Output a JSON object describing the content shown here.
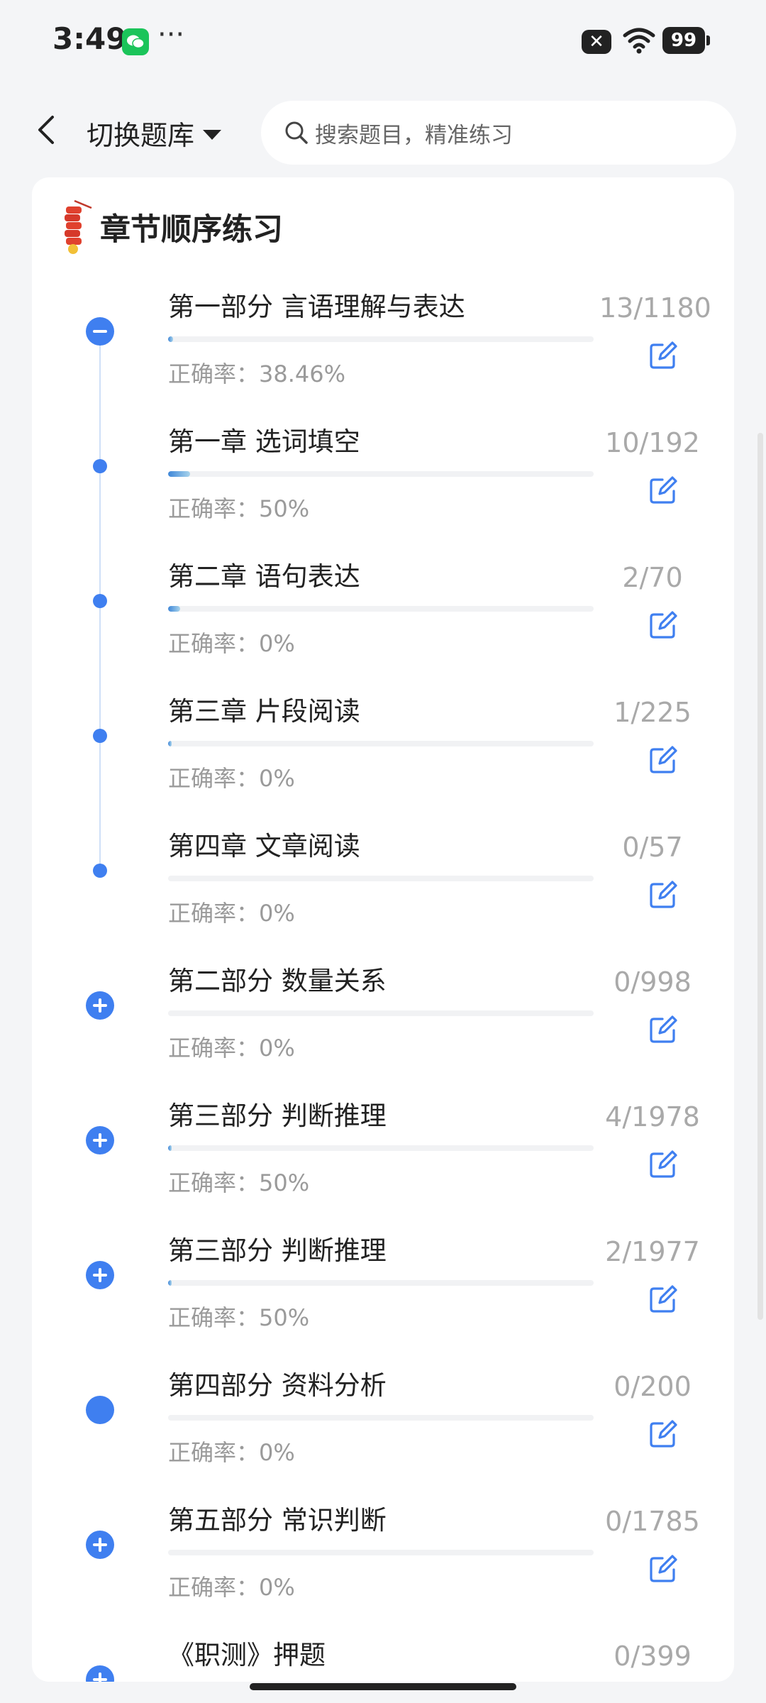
{
  "status": {
    "time": "3:49",
    "dots": "···",
    "battery": "99"
  },
  "header": {
    "switch_label": "切换题库",
    "search_placeholder": "搜索题目，精准练习"
  },
  "card": {
    "title": "章节顺序练习"
  },
  "colors": {
    "accent": "#3f7ff0",
    "count": "#a9a9a9",
    "muted": "#9a9a9a"
  },
  "items": [
    {
      "title": "第一部分 言语理解与表达",
      "count": "13/1180",
      "accuracy": "正确率：38.46%",
      "progress": 0.011,
      "node": "minus"
    },
    {
      "title": "第一章 选词填空",
      "count": "10/192",
      "accuracy": "正确率：50%",
      "progress": 0.052,
      "node": "dot"
    },
    {
      "title": "第二章 语句表达",
      "count": "2/70",
      "accuracy": "正确率：0%",
      "progress": 0.029,
      "node": "dot"
    },
    {
      "title": "第三章 片段阅读",
      "count": "1/225",
      "accuracy": "正确率：0%",
      "progress": 0.004,
      "node": "dot"
    },
    {
      "title": "第四章 文章阅读",
      "count": "0/57",
      "accuracy": "正确率：0%",
      "progress": 0,
      "node": "dot"
    },
    {
      "title": "第二部分 数量关系",
      "count": "0/998",
      "accuracy": "正确率：0%",
      "progress": 0,
      "node": "plus"
    },
    {
      "title": "第三部分 判断推理",
      "count": "4/1978",
      "accuracy": "正确率：50%",
      "progress": 0.002,
      "node": "plus"
    },
    {
      "title": "第三部分 判断推理",
      "count": "2/1977",
      "accuracy": "正确率：50%",
      "progress": 0.001,
      "node": "plus"
    },
    {
      "title": "第四部分 资料分析",
      "count": "0/200",
      "accuracy": "正确率：0%",
      "progress": 0,
      "node": "solid"
    },
    {
      "title": "第五部分 常识判断",
      "count": "0/1785",
      "accuracy": "正确率：0%",
      "progress": 0,
      "node": "plus"
    },
    {
      "title": "《职测》押题",
      "count": "0/399",
      "accuracy": "",
      "progress": 0,
      "node": "plus"
    }
  ]
}
